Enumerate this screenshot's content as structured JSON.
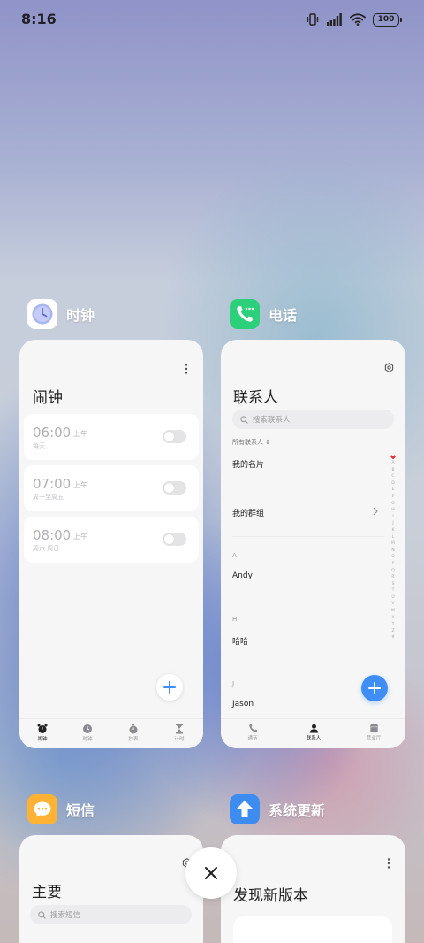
{
  "status_bar": {
    "time": "8:16",
    "battery": "100"
  },
  "apps": {
    "clock": {
      "name": "时钟",
      "title": "闹钟",
      "alarms": [
        {
          "time": "06:00",
          "ampm": "上午",
          "sub": "每天"
        },
        {
          "time": "07:00",
          "ampm": "上午",
          "sub": "周一至周五"
        },
        {
          "time": "08:00",
          "ampm": "上午",
          "sub": "周六 周日"
        }
      ],
      "nav": [
        {
          "label": "闹钟",
          "icon": "alarm-clock-icon"
        },
        {
          "label": "时钟",
          "icon": "clock-icon"
        },
        {
          "label": "秒表",
          "icon": "stopwatch-icon"
        },
        {
          "label": "计时",
          "icon": "hourglass-icon"
        }
      ]
    },
    "phone": {
      "name": "电话",
      "title": "联系人",
      "search_placeholder": "搜索联系人",
      "filter": "所有联系人 ⇕",
      "rows": {
        "my_card": "我的名片",
        "my_groups": "我的群组"
      },
      "sections": [
        {
          "letter": "A",
          "name": "Andy"
        },
        {
          "letter": "H",
          "name": "哈哈"
        },
        {
          "letter": "J",
          "name": "Jason"
        }
      ],
      "alpha_index": [
        "A",
        "B",
        "C",
        "D",
        "E",
        "F",
        "G",
        "H",
        "I",
        "J",
        "K",
        "L",
        "M",
        "N",
        "O",
        "P",
        "Q",
        "R",
        "S",
        "T",
        "U",
        "V",
        "W",
        "X",
        "Y",
        "Z",
        "#"
      ],
      "nav": [
        {
          "label": "通话",
          "icon": "phone-icon"
        },
        {
          "label": "联系人",
          "icon": "person-icon"
        },
        {
          "label": "营业厅",
          "icon": "store-icon"
        }
      ]
    },
    "messages": {
      "name": "短信",
      "title": "主要",
      "search_placeholder": "搜索短信"
    },
    "updater": {
      "name": "系统更新",
      "title": "发现新版本"
    }
  },
  "colors": {
    "accent_blue": "#3f8ef5",
    "clock_icon_bg": "#ffffff",
    "phone_icon_bg": "#2ccf7a",
    "messages_icon_bg": "#ffb233",
    "updater_icon_bg": "#3d8cf0"
  }
}
